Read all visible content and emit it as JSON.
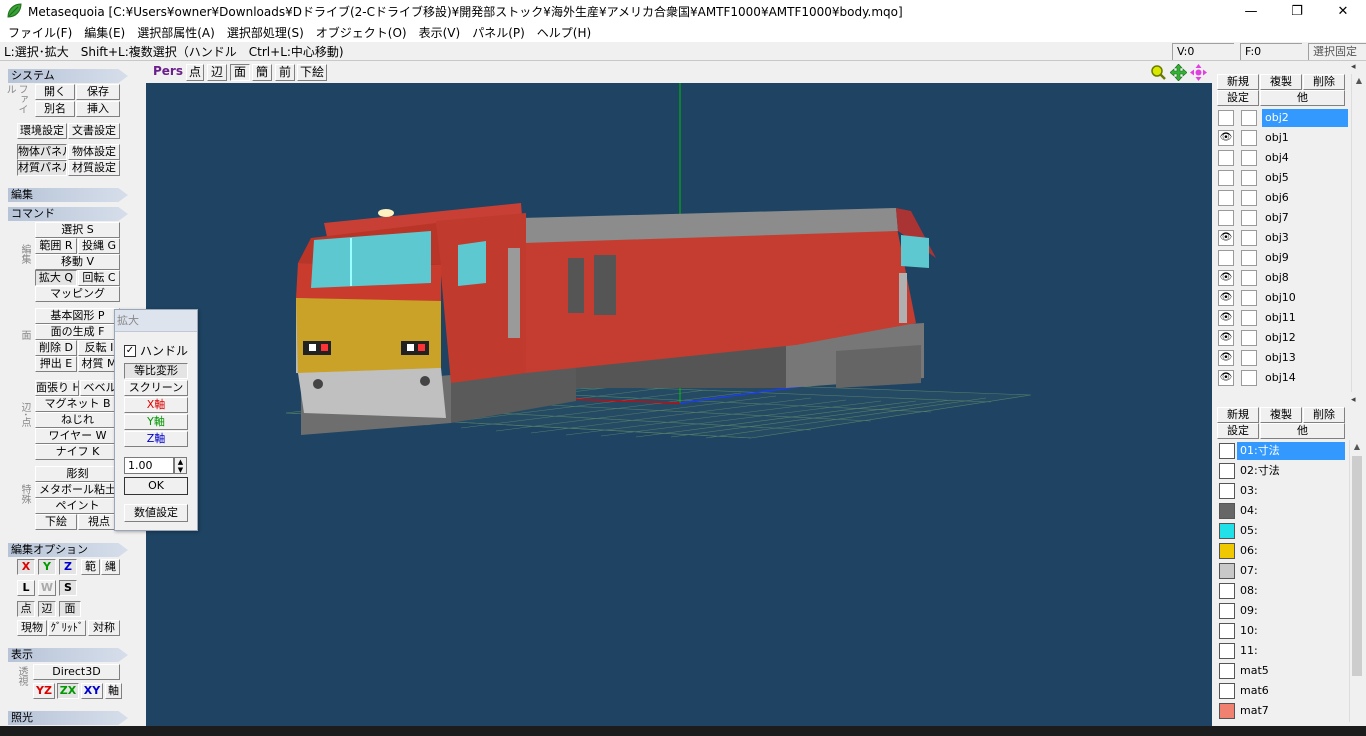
{
  "window": {
    "title": "Metasequoia [C:¥Users¥owner¥Downloads¥Dドライブ(2-Cドライブ移設)¥開発部ストック¥海外生産¥アメリカ合衆国¥AMTF1000¥AMTF1000¥body.mqo]",
    "minimize": "—",
    "maximize": "❐",
    "close": "✕"
  },
  "menu": [
    "ファイル(F)",
    "編集(E)",
    "選択部属性(A)",
    "選択部処理(S)",
    "オブジェクト(O)",
    "表示(V)",
    "パネル(P)",
    "ヘルプ(H)"
  ],
  "status": {
    "hint": "L:選択･拡大　Shift+L:複数選択（ハンドル　Ctrl+L:中心移動)",
    "v": "V:0",
    "f": "F:0",
    "lock": "選択固定"
  },
  "left": {
    "system": {
      "header": "システム",
      "side_label": "ファイル",
      "open": "開く",
      "save": "保存",
      "rename": "別名",
      "insert": "挿入",
      "env": "環境設定",
      "doc": "文書設定",
      "objpanel": "物体パネル",
      "objsettings": "物体設定",
      "matpanel": "材質パネル",
      "matsettings": "材質設定"
    },
    "edit_header": "編集",
    "command": {
      "header": "コマンド",
      "side_label_edit": "編集",
      "select": "選択 S",
      "range": "範囲 R",
      "lasso": "投縄 G",
      "move": "移動 V",
      "scale": "拡大 Q",
      "rotate": "回転 C",
      "mapping": "マッピング",
      "side_label_face": "面",
      "basic": "基本図形 P",
      "genface": "面の生成 F",
      "delete": "削除 D",
      "flip": "反転 I",
      "extrude": "押出 E",
      "material": "材質 M",
      "side_label_edge": "辺･点",
      "bevel_h": "面張り H",
      "bevel": "ベベル",
      "magnet": "マグネット B",
      "twist": "ねじれ",
      "wire": "ワイヤー W",
      "knife": "ナイフ K",
      "side_label_special": "特殊",
      "sculpt": "彫刻",
      "metaball": "メタボール粘土",
      "paint": "ペイント",
      "underlay": "下絵",
      "viewpoint": "視点"
    },
    "editopt": {
      "header": "編集オプション",
      "x": "X",
      "y": "Y",
      "z": "Z",
      "range": "範",
      "lasso": "縄",
      "l": "L",
      "w": "W",
      "s": "S",
      "point": "点",
      "edge": "辺",
      "face": "面",
      "current": "現物",
      "grid": "ｸﾞﾘｯﾄﾞ",
      "symmetry": "対称"
    },
    "display": {
      "header": "表示",
      "side_label": "透視",
      "direct3d": "Direct3D",
      "yz": "YZ",
      "zx": "ZX",
      "xy": "XY",
      "axis": "軸"
    },
    "light_header": "照光"
  },
  "scale_dialog": {
    "title": "拡大",
    "handle_label": "ハンドル",
    "handle_checked": true,
    "proportional": "等比変形",
    "screen": "スクリーン",
    "x_axis": "X軸",
    "y_axis": "Y軸",
    "z_axis": "Z軸",
    "value": "1.00",
    "ok": "OK",
    "numeric": "数値設定"
  },
  "viewport": {
    "mode": "Pers",
    "point": "点",
    "edge": "辺",
    "face": "面",
    "simple": "簡",
    "front": "前",
    "underlay": "下絵",
    "icons": [
      "zoom-icon",
      "move-view-icon",
      "rotate-view-icon"
    ]
  },
  "objects": {
    "new": "新規",
    "copy": "複製",
    "delete": "削除",
    "settings": "設定",
    "other": "他",
    "items": [
      {
        "name": "obj2",
        "visible": false,
        "selected": true
      },
      {
        "name": "obj1",
        "visible": true,
        "selected": false
      },
      {
        "name": "obj4",
        "visible": false,
        "selected": false
      },
      {
        "name": "obj5",
        "visible": false,
        "selected": false
      },
      {
        "name": "obj6",
        "visible": false,
        "selected": false
      },
      {
        "name": "obj7",
        "visible": false,
        "selected": false
      },
      {
        "name": "obj3",
        "visible": true,
        "selected": false
      },
      {
        "name": "obj9",
        "visible": false,
        "selected": false
      },
      {
        "name": "obj8",
        "visible": true,
        "selected": false
      },
      {
        "name": "obj10",
        "visible": true,
        "selected": false
      },
      {
        "name": "obj11",
        "visible": true,
        "selected": false
      },
      {
        "name": "obj12",
        "visible": true,
        "selected": false
      },
      {
        "name": "obj13",
        "visible": true,
        "selected": false
      },
      {
        "name": "obj14",
        "visible": true,
        "selected": false
      }
    ]
  },
  "materials": {
    "new": "新規",
    "copy": "複製",
    "delete": "削除",
    "settings": "設定",
    "other": "他",
    "items": [
      {
        "name": "01:寸法",
        "color": "#ffffff",
        "selected": true
      },
      {
        "name": "02:寸法",
        "color": "#ffffff",
        "selected": false
      },
      {
        "name": "03:",
        "color": "#ffffff",
        "selected": false
      },
      {
        "name": "04:",
        "color": "#666666",
        "selected": false
      },
      {
        "name": "05:",
        "color": "#22e0e8",
        "selected": false
      },
      {
        "name": "06:",
        "color": "#f0c800",
        "selected": false
      },
      {
        "name": "07:",
        "color": "#c8c8c8",
        "selected": false
      },
      {
        "name": "08:",
        "color": "#ffffff",
        "selected": false
      },
      {
        "name": "09:",
        "color": "#ffffff",
        "selected": false
      },
      {
        "name": "10:",
        "color": "#ffffff",
        "selected": false
      },
      {
        "name": "11:",
        "color": "#ffffff",
        "selected": false
      },
      {
        "name": "mat5",
        "color": "#ffffff",
        "selected": false
      },
      {
        "name": "mat6",
        "color": "#ffffff",
        "selected": false
      },
      {
        "name": "mat7",
        "color": "#f08070",
        "selected": false
      }
    ]
  },
  "colors": {
    "viewport_bg": "#1e4363",
    "selection": "#3399ff",
    "loco_body": "#c0392b",
    "loco_roof": "#8a8a8a",
    "loco_front": "#c9a227",
    "window": "#5ec8d0"
  }
}
